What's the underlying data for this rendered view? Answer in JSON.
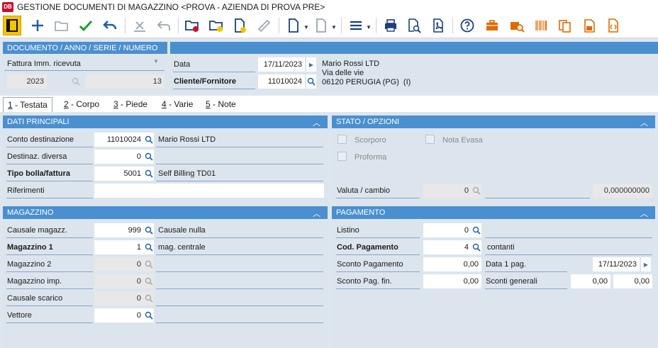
{
  "window": {
    "title": "GESTIONE DOCUMENTI DI MAGAZZINO <PROVA - AZIENDA DI PROVA PRE>",
    "app_icon_text": "DB"
  },
  "colors": {
    "header_blue": "#4a8fd0",
    "active_yellow": "#f5c400",
    "icon_blue": "#1b5fa8",
    "icon_orange": "#e06a00"
  },
  "doc_header": {
    "title": "DOCUMENTO / ANNO / SERIE / NUMERO",
    "doc_type": "Fattura Imm. ricevuta",
    "anno": "2023",
    "numero": "13",
    "data_label": "Data",
    "data_value": "17/11/2023",
    "cliente_label": "Cliente/Fornitore",
    "cliente_value": "11010024",
    "address_name": "Mario Rossi LTD",
    "address_street": "Via delle vie",
    "address_city": "06120 PERUGIA (PG)  (I)"
  },
  "tabs": [
    {
      "key": "1",
      "label": " - Testata"
    },
    {
      "key": "2",
      "label": " - Corpo"
    },
    {
      "key": "3",
      "label": " - Piede"
    },
    {
      "key": "4",
      "label": " - Varie"
    },
    {
      "key": "5",
      "label": " - Note"
    }
  ],
  "dati_principali": {
    "title": "DATI PRINCIPALI",
    "conto_label": "Conto destinazione",
    "conto_value": "11010024",
    "conto_desc": "Mario Rossi LTD",
    "destinaz_label": "Destinaz. diversa",
    "destinaz_value": "0",
    "tipo_label": "Tipo bolla/fattura",
    "tipo_value": "5001",
    "tipo_desc": "Self Billing TD01",
    "riferimenti_label": "Riferimenti"
  },
  "stato_opzioni": {
    "title": "STATO / OPZIONI",
    "scorporo": "Scorporo",
    "nota_evasa": "Nota Evasa",
    "proforma": "Proforma",
    "valuta_label": "Valuta / cambio",
    "valuta_value": "0",
    "cambio_value": "0,000000000"
  },
  "magazzino": {
    "title": "MAGAZZINO",
    "causale_label": "Causale magazz.",
    "causale_value": "999",
    "causale_desc": "Causale nulla",
    "mag1_label": "Magazzino 1",
    "mag1_value": "1",
    "mag1_desc": "mag. centrale",
    "mag2_label": "Magazzino 2",
    "mag2_value": "0",
    "magimp_label": "Magazzino imp.",
    "magimp_value": "0",
    "scarico_label": "Causale scarico",
    "scarico_value": "0",
    "vettore_label": "Vettore",
    "vettore_value": "0"
  },
  "pagamento": {
    "title": "PAGAMENTO",
    "listino_label": "Listino",
    "listino_value": "0",
    "codpag_label": "Cod. Pagamento",
    "codpag_value": "4",
    "codpag_desc": "contanti",
    "sconto_label": "Sconto Pagamento",
    "sconto_value": "0,00",
    "data1_label": "Data 1 pag.",
    "data1_value": "17/11/2023",
    "scontofin_label": "Sconto Pag. fin.",
    "scontofin_value": "0,00",
    "sconti_gen_label": "Sconti generali",
    "sconti_gen_1": "0,00",
    "sconti_gen_2": "0,00"
  }
}
